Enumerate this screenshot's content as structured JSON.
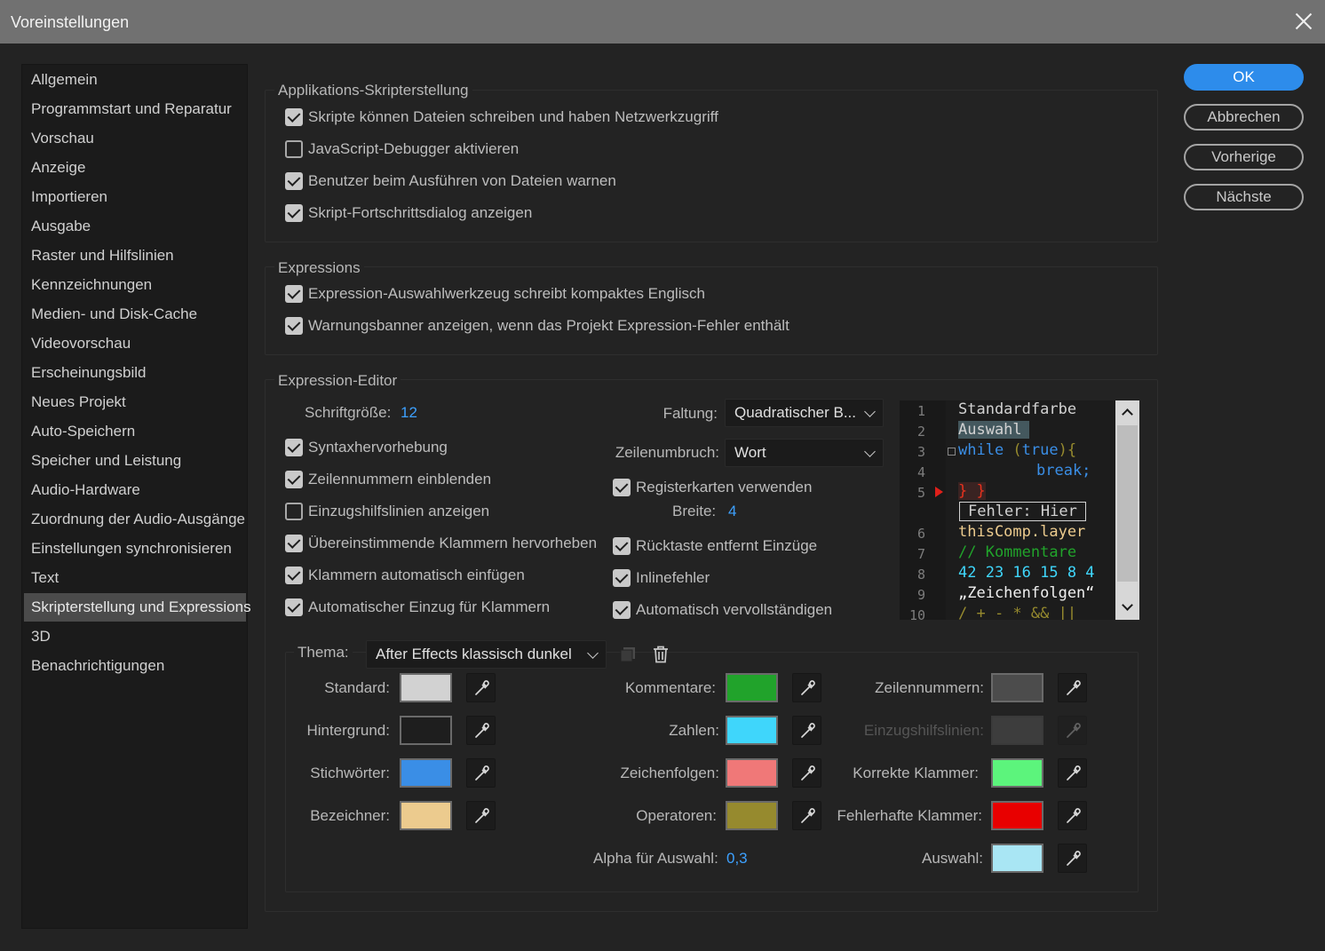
{
  "window": {
    "title": "Voreinstellungen"
  },
  "sidebar": {
    "items": [
      "Allgemein",
      "Programmstart und Reparatur",
      "Vorschau",
      "Anzeige",
      "Importieren",
      "Ausgabe",
      "Raster und Hilfslinien",
      "Kennzeichnungen",
      "Medien- und Disk-Cache",
      "Videovorschau",
      "Erscheinungsbild",
      "Neues Projekt",
      "Auto-Speichern",
      "Speicher und Leistung",
      "Audio-Hardware",
      "Zuordnung der Audio-Ausgänge",
      "Einstellungen synchronisieren",
      "Text",
      "Skripterstellung und Expressions",
      "3D",
      "Benachrichtigungen"
    ],
    "selected": "Skripterstellung und Expressions"
  },
  "buttons": {
    "ok": "OK",
    "cancel": "Abbrechen",
    "previous": "Vorherige",
    "next": "Nächste"
  },
  "scripting": {
    "title": "Applikations-Skripterstellung",
    "options": [
      {
        "label": "Skripte können Dateien schreiben und haben Netzwerkzugriff",
        "checked": true
      },
      {
        "label": "JavaScript-Debugger aktivieren",
        "checked": false
      },
      {
        "label": "Benutzer beim Ausführen von Dateien warnen",
        "checked": true
      },
      {
        "label": "Skript-Fortschrittsdialog anzeigen",
        "checked": true
      }
    ]
  },
  "expressions": {
    "title": "Expressions",
    "options": [
      {
        "label": "Expression-Auswahlwerkzeug schreibt kompaktes Englisch",
        "checked": true
      },
      {
        "label": "Warnungsbanner anzeigen, wenn das Projekt Expression-Fehler enthält",
        "checked": true
      }
    ]
  },
  "editor": {
    "title": "Expression-Editor",
    "font_size_label": "Schriftgröße:",
    "font_size_value": "12",
    "folding_label": "Faltung:",
    "folding_value": "Quadratischer B...",
    "wrap_label": "Zeilenumbruch:",
    "wrap_value": "Wort",
    "tab_width_label": "Breite:",
    "tab_width_value": "4",
    "left_options": [
      {
        "label": "Syntaxhervorhebung",
        "checked": true
      },
      {
        "label": "Zeilennummern einblenden",
        "checked": true
      },
      {
        "label": "Einzugshilfslinien anzeigen",
        "checked": false
      },
      {
        "label": "Übereinstimmende Klammern hervorheben",
        "checked": true
      },
      {
        "label": "Klammern automatisch einfügen",
        "checked": true
      },
      {
        "label": "Automatischer Einzug für Klammern",
        "checked": true
      }
    ],
    "mid_options": [
      {
        "label": "Registerkarten verwenden",
        "checked": true
      },
      {
        "label": "Rücktaste entfernt Einzüge",
        "checked": true
      },
      {
        "label": "Inlinefehler",
        "checked": true
      },
      {
        "label": "Automatisch vervollständigen",
        "checked": true
      }
    ],
    "preview": {
      "line_numbers": [
        "1",
        "2",
        "3",
        "4",
        "5",
        "6",
        "7",
        "8",
        "9",
        "10"
      ],
      "lines": {
        "l1": "Standardfarbe",
        "l2": "Auswahl",
        "l3_kw": "while",
        "l3_paren": " (",
        "l3_true": "true",
        "l3_end": "){",
        "l4": "break;",
        "l5": "} }",
        "error": "Fehler: Hier",
        "l6": "thisComp.layer",
        "l7": "// Kommentare",
        "l8": "42 23 16 15 8 4",
        "l9": "„Zeichenfolgen“",
        "l10": "/ + - * && ||"
      }
    }
  },
  "theme": {
    "label": "Thema:",
    "value": "After Effects klassisch dunkel",
    "alpha_label": "Alpha für Auswahl:",
    "alpha_value": "0,3",
    "colors": [
      {
        "label": "Standard:",
        "color": "#d2d2d2"
      },
      {
        "label": "Hintergrund:",
        "color": "#1e1e1e"
      },
      {
        "label": "Stichwörter:",
        "color": "#3a8ee6"
      },
      {
        "label": "Bezeichner:",
        "color": "#eccb8e"
      },
      {
        "label": "Kommentare:",
        "color": "#21a32b"
      },
      {
        "label": "Zahlen:",
        "color": "#3fd6fb"
      },
      {
        "label": "Zeichenfolgen:",
        "color": "#f07878"
      },
      {
        "label": "Operatoren:",
        "color": "#968a2e"
      },
      {
        "label": "Zeilennummern:",
        "color": "#4c4c4c"
      },
      {
        "label": "Einzugshilfslinien:",
        "color": "#3d3d3d"
      },
      {
        "label": "Korrekte Klammer:",
        "color": "#5cf47c"
      },
      {
        "label": "Fehlerhafte Klammer:",
        "color": "#e80000"
      },
      {
        "label": "Auswahl:",
        "color": "#a9e6f4"
      }
    ]
  },
  "icons": [
    "close-icon",
    "duplicate-icon",
    "trash-icon",
    "eyedropper-icon",
    "chevron-down-icon",
    "chevron-up-icon",
    "error-marker-icon"
  ]
}
